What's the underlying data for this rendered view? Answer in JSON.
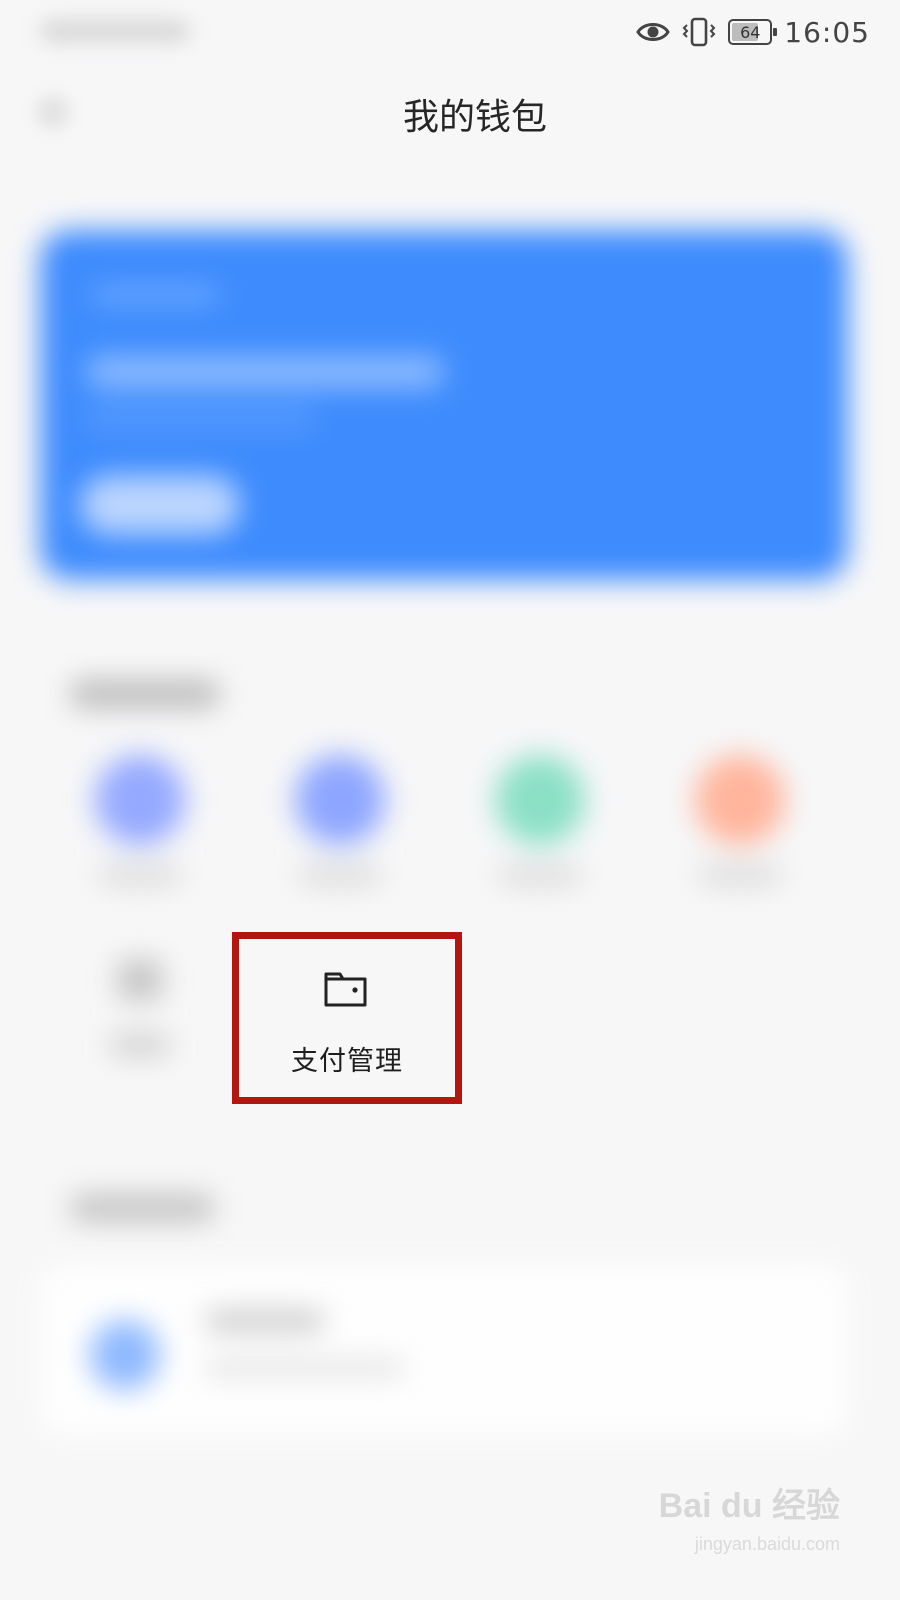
{
  "status_bar": {
    "time": "16:05",
    "battery_level": "64",
    "icons": [
      "eye-icon",
      "vibrate-icon",
      "battery-icon"
    ]
  },
  "header": {
    "title": "我的钱包"
  },
  "highlighted_item": {
    "label": "支付管理",
    "icon": "wallet-icon",
    "highlight_color": "#b3150f"
  },
  "watermark": {
    "logo": "Bai du 经验",
    "url": "jingyan.baidu.com"
  },
  "colors": {
    "card": "#3d8bfd",
    "background": "#f7f7f8"
  }
}
